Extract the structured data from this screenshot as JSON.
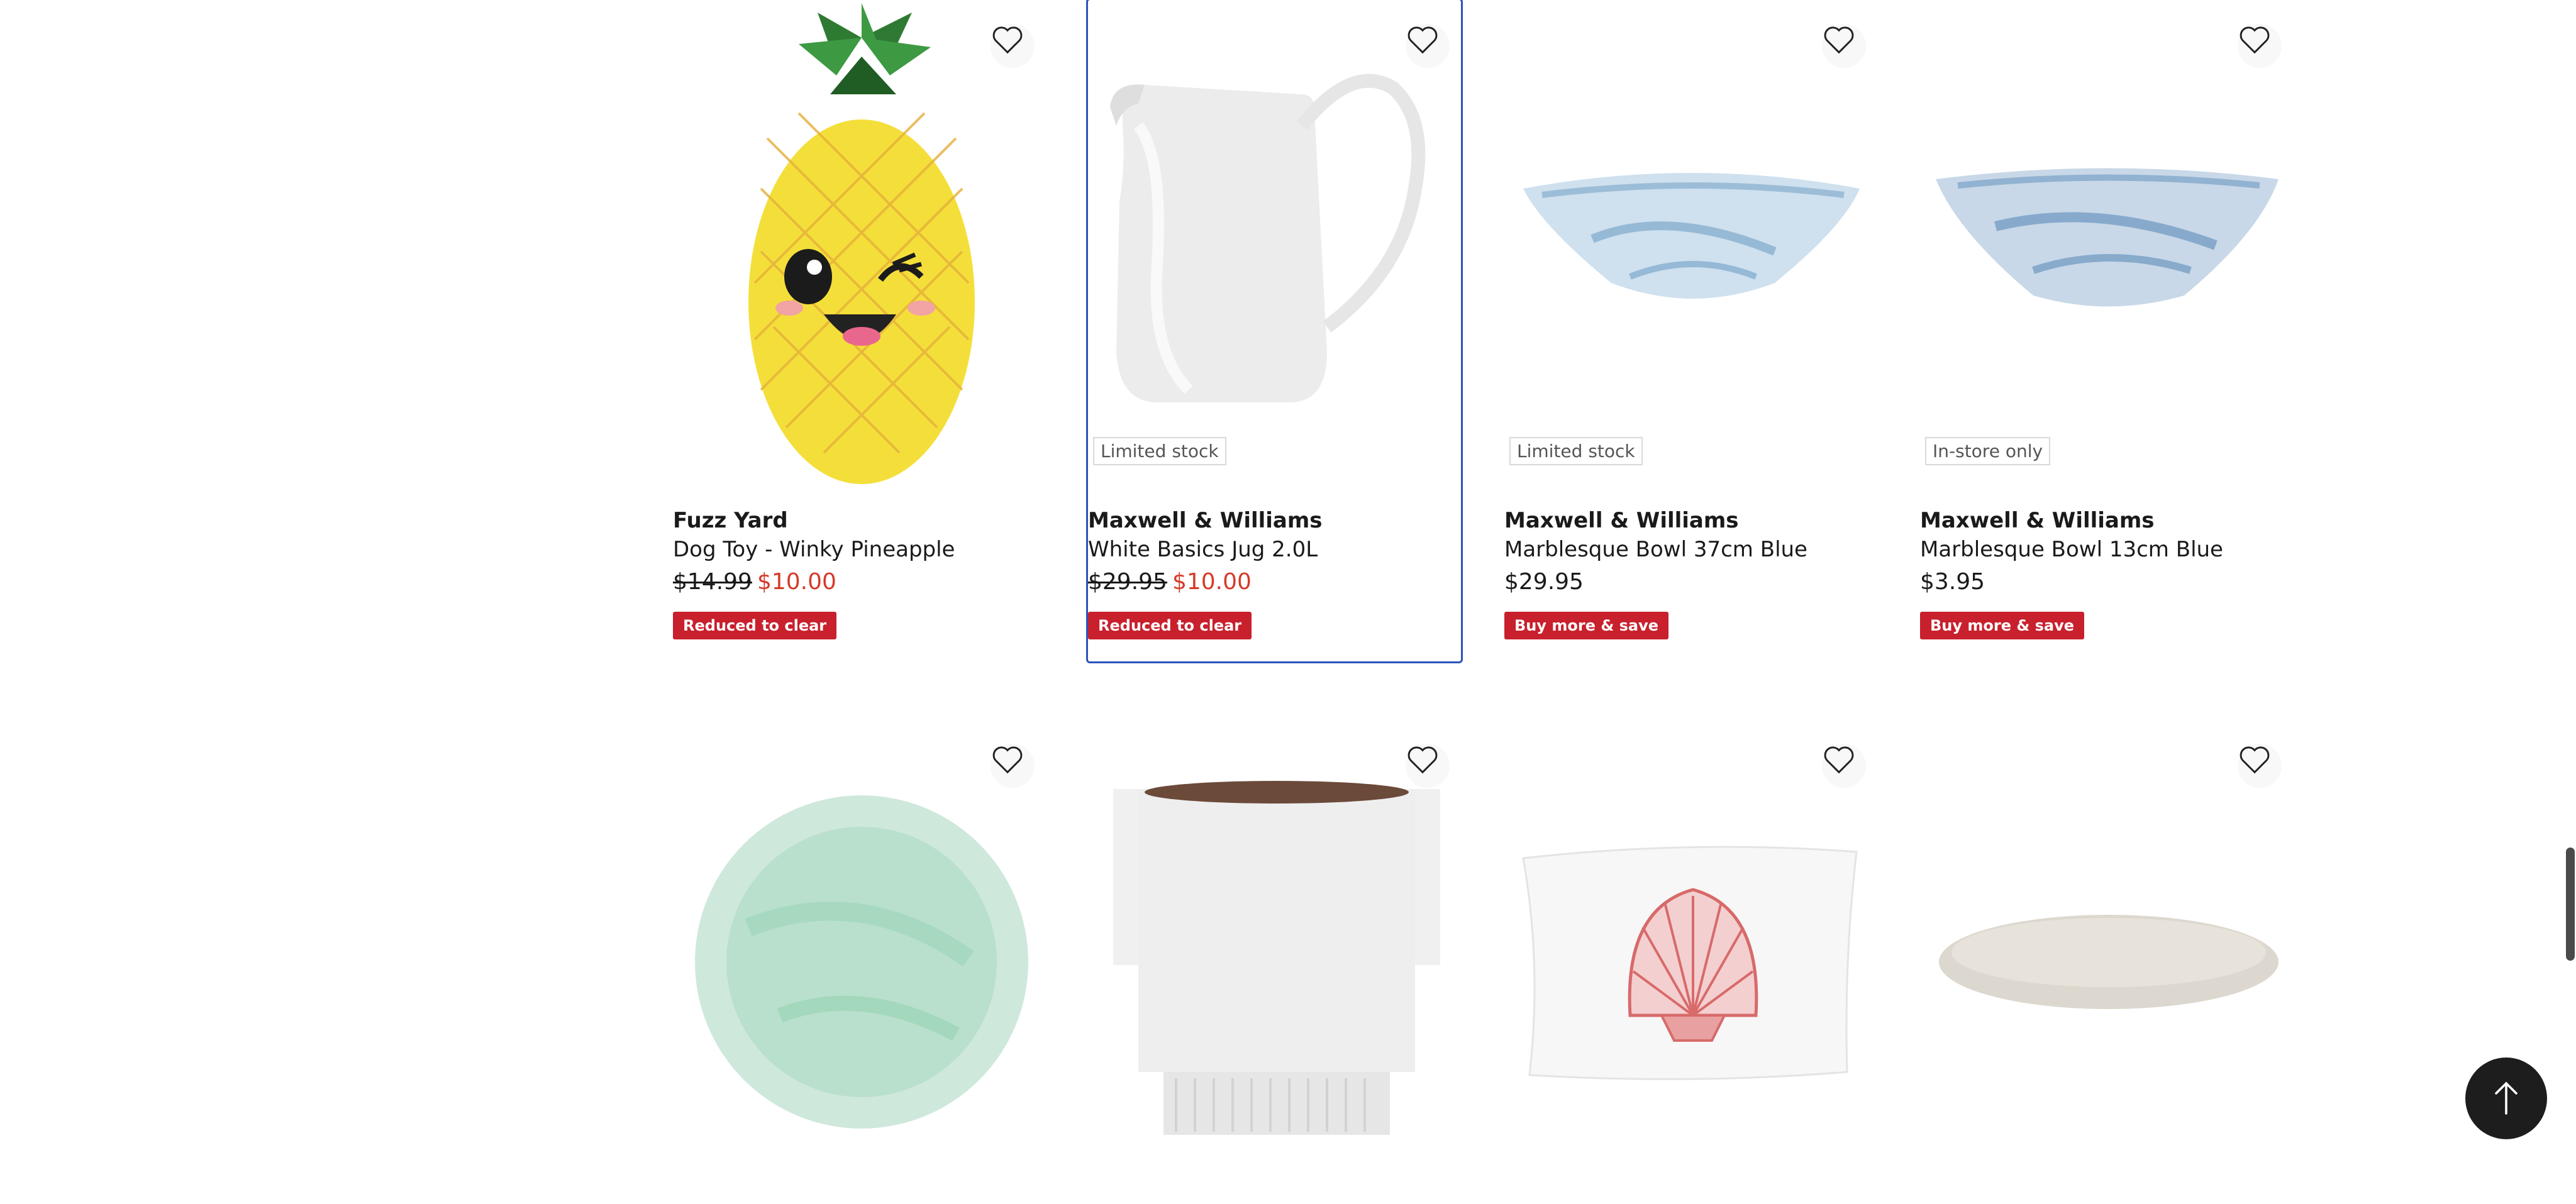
{
  "row1": [
    {
      "stock": "",
      "brand": "Fuzz Yard",
      "name": "Dog Toy - Winky Pineapple",
      "was": "$14.99",
      "now": "$10.00",
      "price": "",
      "badge": "Reduced to clear"
    },
    {
      "stock": "Limited stock",
      "brand": "Maxwell & Williams",
      "name": "White Basics Jug 2.0L",
      "was": "$29.95",
      "now": "$10.00",
      "price": "",
      "badge": "Reduced to clear"
    },
    {
      "stock": "Limited stock",
      "brand": "Maxwell & Williams",
      "name": "Marblesque Bowl 37cm Blue",
      "was": "",
      "now": "",
      "price": "$29.95",
      "badge": "Buy more & save"
    },
    {
      "stock": "In-store only",
      "brand": "Maxwell & Williams",
      "name": "Marblesque Bowl 13cm Blue",
      "was": "",
      "now": "",
      "price": "$3.95",
      "badge": "Buy more & save"
    }
  ],
  "icons": {
    "favourite": "heart-outline-icon",
    "back_to_top": "arrow-up-icon"
  },
  "colors": {
    "sale_price": "#d63a2a",
    "badge_bg": "#c8202d",
    "focus_outline": "#2b53b8",
    "back_to_top_bg": "#1d1d1d"
  }
}
